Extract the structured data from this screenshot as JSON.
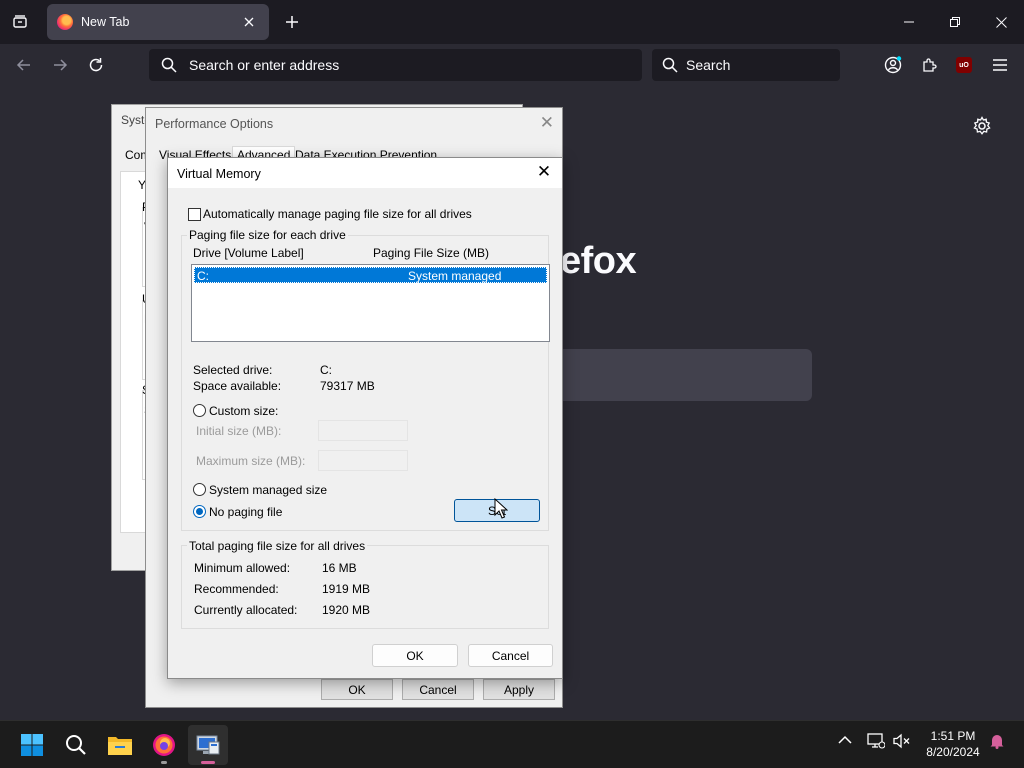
{
  "browser": {
    "tab_title": "New Tab",
    "url_placeholder": "Search or enter address",
    "search_placeholder": "Search",
    "brand_text": "efox"
  },
  "system_properties": {
    "caption": "Syste",
    "tab_stub": "Com",
    "stubs": [
      "Yo",
      "P",
      "V",
      "U",
      "D",
      "S",
      "S"
    ]
  },
  "performance_options": {
    "caption": "Performance Options",
    "tabs": [
      "Visual Effects",
      "Advanced",
      "Data Execution Prevention"
    ],
    "buttons": {
      "ok": "OK",
      "cancel": "Cancel",
      "apply": "Apply"
    }
  },
  "virtual_memory": {
    "title": "Virtual Memory",
    "auto_manage_label": "Automatically manage paging file size for all drives",
    "auto_manage_checked": false,
    "per_drive_group": "Paging file size for each drive",
    "col_drive": "Drive  [Volume Label]",
    "col_size": "Paging File Size (MB)",
    "drives": [
      {
        "drive": "C:",
        "size": "System managed",
        "selected": true
      }
    ],
    "selected_drive_label": "Selected drive:",
    "selected_drive_value": "C:",
    "space_available_label": "Space available:",
    "space_available_value": "79317 MB",
    "custom_size_label": "Custom size:",
    "initial_size_label": "Initial size (MB):",
    "maximum_size_label": "Maximum size (MB):",
    "system_managed_label": "System managed size",
    "no_paging_label": "No paging file",
    "selected_option": "no_paging",
    "set_button": "Set",
    "total_group": "Total paging file size for all drives",
    "minimum_label": "Minimum allowed:",
    "minimum_value": "16 MB",
    "recommended_label": "Recommended:",
    "recommended_value": "1919 MB",
    "allocated_label": "Currently allocated:",
    "allocated_value": "1920 MB",
    "ok": "OK",
    "cancel": "Cancel"
  },
  "taskbar": {
    "time": "1:51 PM",
    "date": "8/20/2024"
  },
  "colors": {
    "browser_bg": "#1c1b22",
    "toolbar_bg": "#2b2a33",
    "accent": "#0078d7",
    "taskbar_bg": "#1c1c1c"
  }
}
